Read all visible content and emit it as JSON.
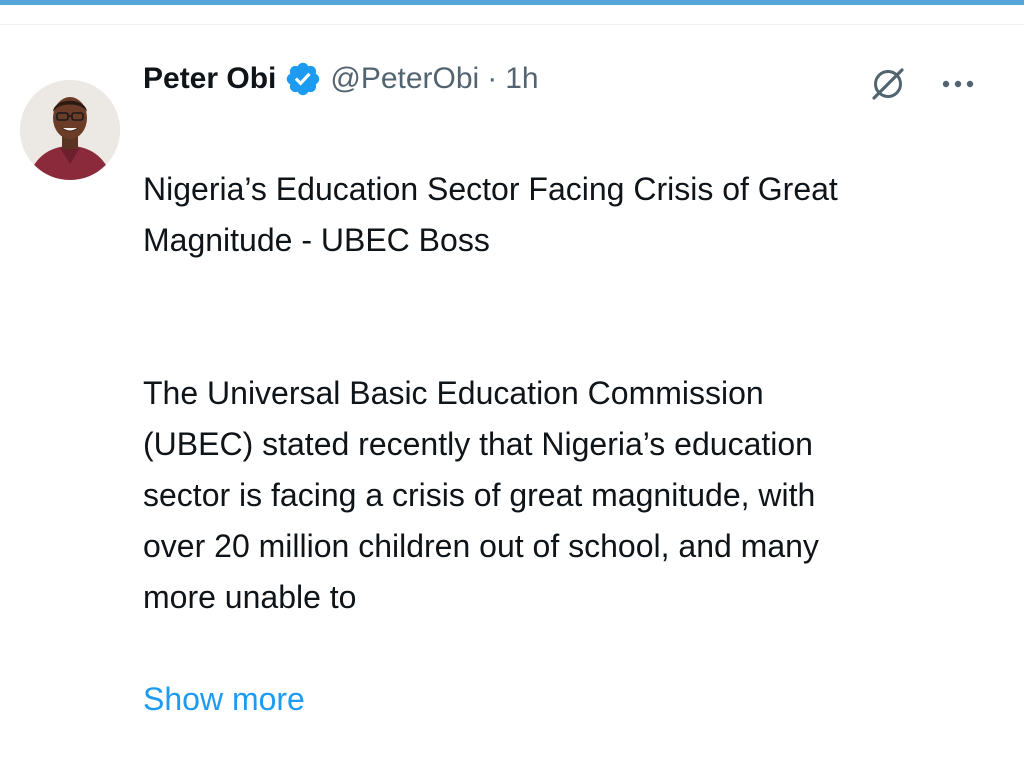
{
  "tweet": {
    "author": {
      "display_name": "Peter Obi",
      "handle": "@PeterObi",
      "verified": true,
      "avatar": "avatar-photo"
    },
    "separator": "·",
    "time": "1h",
    "icons": {
      "grok": "grok-icon",
      "more": "more-options-icon",
      "verified": "verified-badge-icon"
    },
    "headline": "Nigeria’s Education Sector Facing Crisis of Great\nMagnitude - UBEC Boss",
    "body": "The Universal Basic Education Commission\n(UBEC) stated recently that Nigeria’s education\nsector is facing a crisis of great magnitude, with\nover 20 million children out of school, and many\nmore unable to",
    "show_more_label": "Show more"
  },
  "colors": {
    "text_primary": "#0f1419",
    "text_secondary": "#536471",
    "link": "#1d9bf0",
    "verified_badge": "#1d9bf0",
    "top_accent": "#57a6db"
  }
}
